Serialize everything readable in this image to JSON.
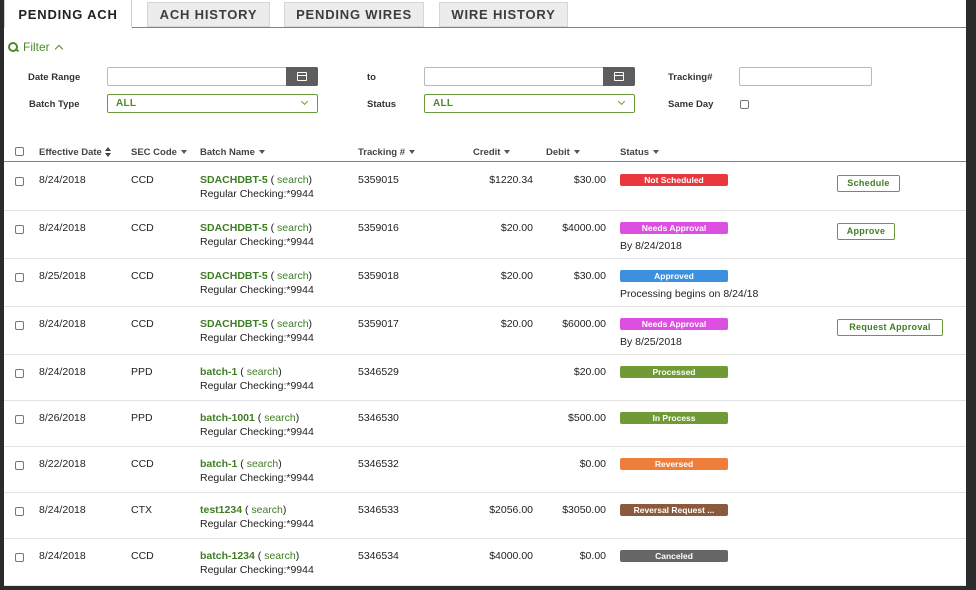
{
  "tabs": [
    {
      "label": "PENDING ACH",
      "active": true
    },
    {
      "label": "ACH HISTORY",
      "active": false
    },
    {
      "label": "PENDING WIRES",
      "active": false
    },
    {
      "label": "WIRE HISTORY",
      "active": false
    }
  ],
  "filter": {
    "toggle_label": "Filter",
    "date_range_label": "Date Range",
    "to_label": "to",
    "tracking_label": "Tracking#",
    "batch_type_label": "Batch Type",
    "batch_type_value": "ALL",
    "status_label": "Status",
    "status_value": "ALL",
    "same_day_label": "Same Day"
  },
  "table": {
    "headers": {
      "effective_date": "Effective Date",
      "sec_code": "SEC Code",
      "batch_name": "Batch Name",
      "tracking": "Tracking #",
      "credit": "Credit",
      "debit": "Debit",
      "status": "Status"
    },
    "search_word": "search",
    "rows": [
      {
        "date": "8/24/2018",
        "sec": "CCD",
        "batch": "SDACHDBT-5",
        "account": "Regular Checking:*9944",
        "tracking": "5359015",
        "credit": "$1220.34",
        "debit": "$30.00",
        "status": "Not Scheduled",
        "status_color": "#e8383d",
        "status_sub": "",
        "action": "Schedule"
      },
      {
        "date": "8/24/2018",
        "sec": "CCD",
        "batch": "SDACHDBT-5",
        "account": "Regular Checking:*9944",
        "tracking": "5359016",
        "credit": "$20.00",
        "debit": "$4000.00",
        "status": "Needs Approval",
        "status_color": "#dc4fe0",
        "status_sub": "By 8/24/2018",
        "action": "Approve"
      },
      {
        "date": "8/25/2018",
        "sec": "CCD",
        "batch": "SDACHDBT-5",
        "account": "Regular Checking:*9944",
        "tracking": "5359018",
        "credit": "$20.00",
        "debit": "$30.00",
        "status": "Approved",
        "status_color": "#3d8fe0",
        "status_sub": "Processing begins on 8/24/18",
        "action": ""
      },
      {
        "date": "8/24/2018",
        "sec": "CCD",
        "batch": "SDACHDBT-5",
        "account": "Regular Checking:*9944",
        "tracking": "5359017",
        "credit": "$20.00",
        "debit": "$6000.00",
        "status": "Needs Approval",
        "status_color": "#dc4fe0",
        "status_sub": "By 8/25/2018",
        "action": "Request Approval"
      },
      {
        "date": "8/24/2018",
        "sec": "PPD",
        "batch": "batch-1",
        "account": "Regular Checking:*9944",
        "tracking": "5346529",
        "credit": "",
        "debit": "$20.00",
        "status": "Processed",
        "status_color": "#6f9a35",
        "status_sub": "",
        "action": ""
      },
      {
        "date": "8/26/2018",
        "sec": "PPD",
        "batch": "batch-1001",
        "account": "Regular Checking:*9944",
        "tracking": "5346530",
        "credit": "",
        "debit": "$500.00",
        "status": "In Process",
        "status_color": "#6f9a35",
        "status_sub": "",
        "action": ""
      },
      {
        "date": "8/22/2018",
        "sec": "CCD",
        "batch": "batch-1",
        "account": "Regular Checking:*9944",
        "tracking": "5346532",
        "credit": "",
        "debit": "$0.00",
        "status": "Reversed",
        "status_color": "#ef7d3c",
        "status_sub": "",
        "action": ""
      },
      {
        "date": "8/24/2018",
        "sec": "CTX",
        "batch": "test1234",
        "account": "Regular Checking:*9944",
        "tracking": "5346533",
        "credit": "$2056.00",
        "debit": "$3050.00",
        "status": "Reversal Request ...",
        "status_color": "#8b5a3c",
        "status_sub": "",
        "action": ""
      },
      {
        "date": "8/24/2018",
        "sec": "CCD",
        "batch": "batch-1234",
        "account": "Regular Checking:*9944",
        "tracking": "5346534",
        "credit": "$4000.00",
        "debit": "$0.00",
        "status": "Canceled",
        "status_color": "#666666",
        "status_sub": "",
        "action": ""
      }
    ]
  }
}
